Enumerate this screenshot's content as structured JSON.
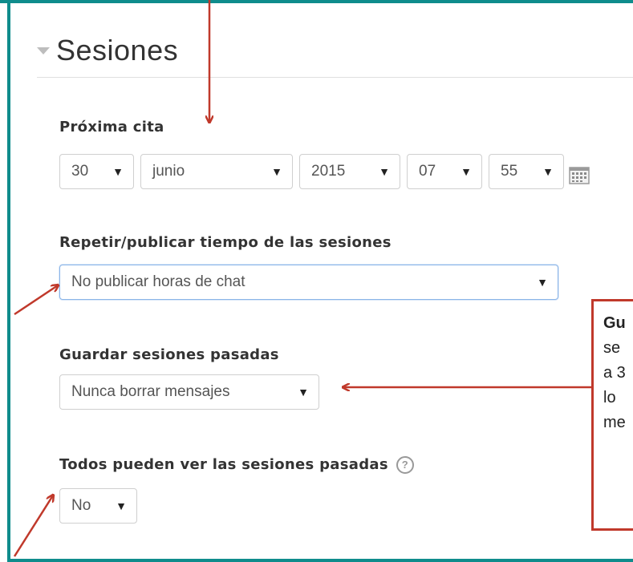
{
  "section": {
    "title": "Sesiones"
  },
  "next_appointment": {
    "label": "Próxima cita",
    "day": "30",
    "month": "junio",
    "year": "2015",
    "hour": "07",
    "minute": "55"
  },
  "repeat_sessions": {
    "label": "Repetir/publicar tiempo de las sesiones",
    "value": "No publicar horas de chat"
  },
  "keep_sessions": {
    "label": "Guardar sesiones pasadas",
    "value": "Nunca borrar mensajes"
  },
  "everyone_sees": {
    "label": "Todos pueden ver las sesiones pasadas",
    "value": "No"
  },
  "callout": {
    "lines": [
      "Gu",
      "se",
      "a 3",
      "lo",
      "me"
    ]
  },
  "colors": {
    "frame": "#0f8c8c",
    "arrow": "#c0392b",
    "focus": "#8ab4e8"
  },
  "icons": {
    "collapse": "caret-down-icon",
    "calendar": "calendar-icon",
    "help": "help-icon"
  }
}
